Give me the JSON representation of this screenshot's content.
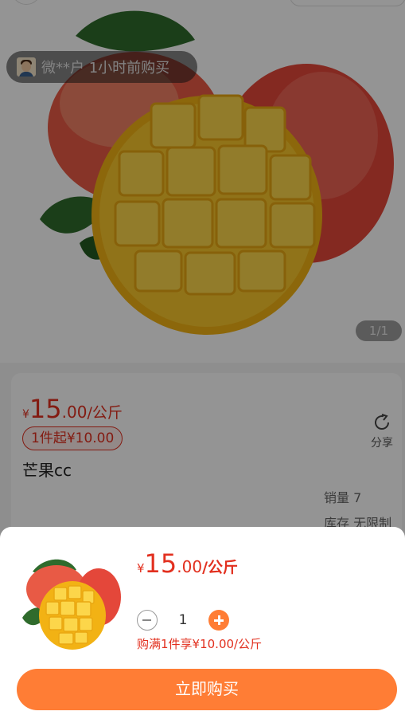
{
  "buyer_toast": {
    "text": "微**户 1小时前购买"
  },
  "gallery": {
    "counter": "1/1"
  },
  "product": {
    "currency": "¥",
    "price_int": "15",
    "price_dec": ".00",
    "unit": "/公斤",
    "min_tag": "1件起¥10.00",
    "name": "芒果cc",
    "share_label": "分享",
    "sales": "销量 7",
    "stock": "库存 无限制"
  },
  "sheet": {
    "currency": "¥",
    "price_int": "15",
    "price_dec": ".00",
    "unit": "/公斤",
    "quantity": "1",
    "discount_note": "购满1件享¥10.00/公斤",
    "buy_label": "立即购买"
  },
  "colors": {
    "accent": "#ff7d35",
    "price": "#e2301f"
  },
  "icons": [
    "avatar-icon",
    "share-icon",
    "minus-icon",
    "plus-icon",
    "customer-service-icon"
  ]
}
